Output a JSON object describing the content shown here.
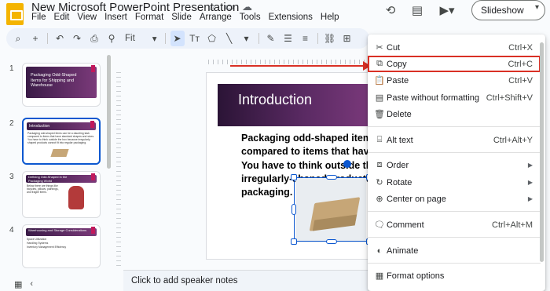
{
  "app": {
    "doc_title": "New Microsoft PowerPoint Presentation",
    "menu": [
      "File",
      "Edit",
      "View",
      "Insert",
      "Format",
      "Slide",
      "Arrange",
      "Tools",
      "Extensions",
      "Help"
    ],
    "slideshow_label": "Slideshow"
  },
  "toolbar": {
    "zoom_label": "Fit"
  },
  "filmstrip": {
    "slides": [
      {
        "number": "1",
        "title": "Packaging Odd-Shaped Items for Shipping and Warehouse"
      },
      {
        "number": "2",
        "title": "Introduction",
        "body": "Packaging odd-shaped items can be a daunting task compared to items that have standard shapes and sizes. You have to think outside the box because irregularly-shaped products cannot fit into regular packaging."
      },
      {
        "number": "3",
        "title": "Defining Odd-Shaped in the Packaging World",
        "body": "Below there are things like bicycles, pillows, paintings, and fragile items."
      },
      {
        "number": "4",
        "title": "Warehousing and Storage Considerations",
        "bullets": [
          "Space Utilization",
          "Handling Systems",
          "Inventory Management Efficiency"
        ]
      }
    ]
  },
  "slide": {
    "title": "Introduction",
    "body_lines": [
      "Packaging odd-shaped items c",
      "compared to items that have s",
      "You have to think outside the b",
      "irregularly-shaped products ca",
      "packaging."
    ]
  },
  "notes_placeholder": "Click to add speaker notes",
  "context_menu": {
    "items": [
      {
        "icon": "scissors-icon",
        "glyph": "✂",
        "label": "Cut",
        "shortcut": "Ctrl+X"
      },
      {
        "icon": "copy-icon",
        "glyph": "⧉",
        "label": "Copy",
        "shortcut": "Ctrl+C",
        "highlighted": true
      },
      {
        "icon": "paste-icon",
        "glyph": "📋",
        "label": "Paste",
        "shortcut": "Ctrl+V"
      },
      {
        "icon": "paste-plain-icon",
        "glyph": "▤",
        "label": "Paste without formatting",
        "shortcut": "Ctrl+Shift+V"
      },
      {
        "icon": "trash-icon",
        "glyph": "🗑",
        "label": "Delete",
        "shortcut": ""
      },
      {
        "icon": "alt-text-icon",
        "glyph": "⌸",
        "label": "Alt text",
        "shortcut": "Ctrl+Alt+Y"
      },
      {
        "icon": "order-icon",
        "glyph": "⧈",
        "label": "Order",
        "shortcut": "",
        "submenu": true
      },
      {
        "icon": "rotate-icon",
        "glyph": "↻",
        "label": "Rotate",
        "shortcut": "",
        "submenu": true
      },
      {
        "icon": "center-icon",
        "glyph": "⊕",
        "label": "Center on page",
        "shortcut": "",
        "submenu": true
      },
      {
        "icon": "comment-icon",
        "glyph": "🗨",
        "label": "Comment",
        "shortcut": "Ctrl+Alt+M"
      },
      {
        "icon": "animate-icon",
        "glyph": "◐",
        "label": "Animate",
        "shortcut": ""
      },
      {
        "icon": "format-options-icon",
        "glyph": "▦",
        "label": "Format options",
        "shortcut": ""
      }
    ]
  },
  "colors": {
    "accent": "#0b57d0",
    "highlight_outline": "#d93025",
    "slide_band": "#5a2a63"
  }
}
